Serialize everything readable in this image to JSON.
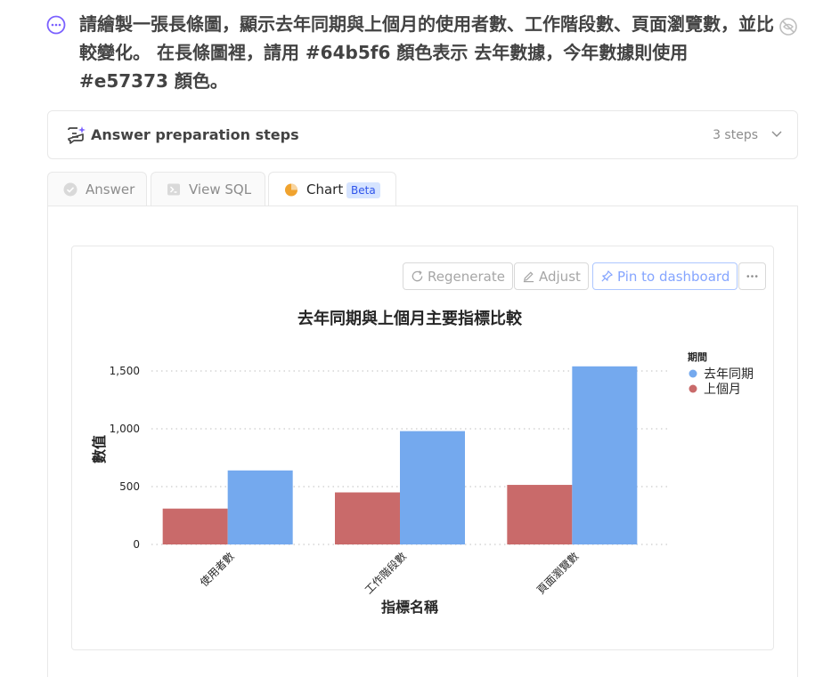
{
  "question": {
    "text": "請繪製一張長條圖，顯示去年同期與上個月的使用者數、工作階段數、頁面瀏覽數，並比較變化。 在長條圖裡，請用 #64b5f6 顏色表示 去年數據，今年數據則使用 #e57373 顏色。"
  },
  "preparation": {
    "title": "Answer preparation steps",
    "count": "3 steps"
  },
  "tabs": [
    {
      "label": "Answer",
      "icon": "check-circle-icon"
    },
    {
      "label": "View SQL",
      "icon": "terminal-icon"
    },
    {
      "label": "Chart",
      "icon": "pie-chart-icon",
      "badge": "Beta",
      "active": true
    }
  ],
  "actions": {
    "regenerate": "Regenerate",
    "adjust": "Adjust",
    "pin": "Pin to dashboard"
  },
  "colors": {
    "last_year": "#74a9ee",
    "last_month": "#c96a6a",
    "accent": "#2f54eb",
    "icon_purple": "#7b61ff"
  },
  "chart_data": {
    "type": "bar",
    "title": "去年同期與上個月主要指標比較",
    "xlabel": "指標名稱",
    "ylabel": "數值",
    "ylim": [
      0,
      1600
    ],
    "yticks": [
      0,
      500,
      1000,
      1500
    ],
    "ytick_labels": [
      "0",
      "500",
      "1,000",
      "1,500"
    ],
    "categories": [
      "使用者數",
      "工作階段數",
      "頁面瀏覽數"
    ],
    "legend_title": "期間",
    "legend_position": "top-right",
    "grid": true,
    "series": [
      {
        "name": "上個月",
        "values": [
          310,
          450,
          515
        ],
        "color": "#c96a6a"
      },
      {
        "name": "去年同期",
        "values": [
          640,
          980,
          1540
        ],
        "color": "#74a9ee"
      }
    ],
    "legend_order": [
      "去年同期",
      "上個月"
    ]
  }
}
